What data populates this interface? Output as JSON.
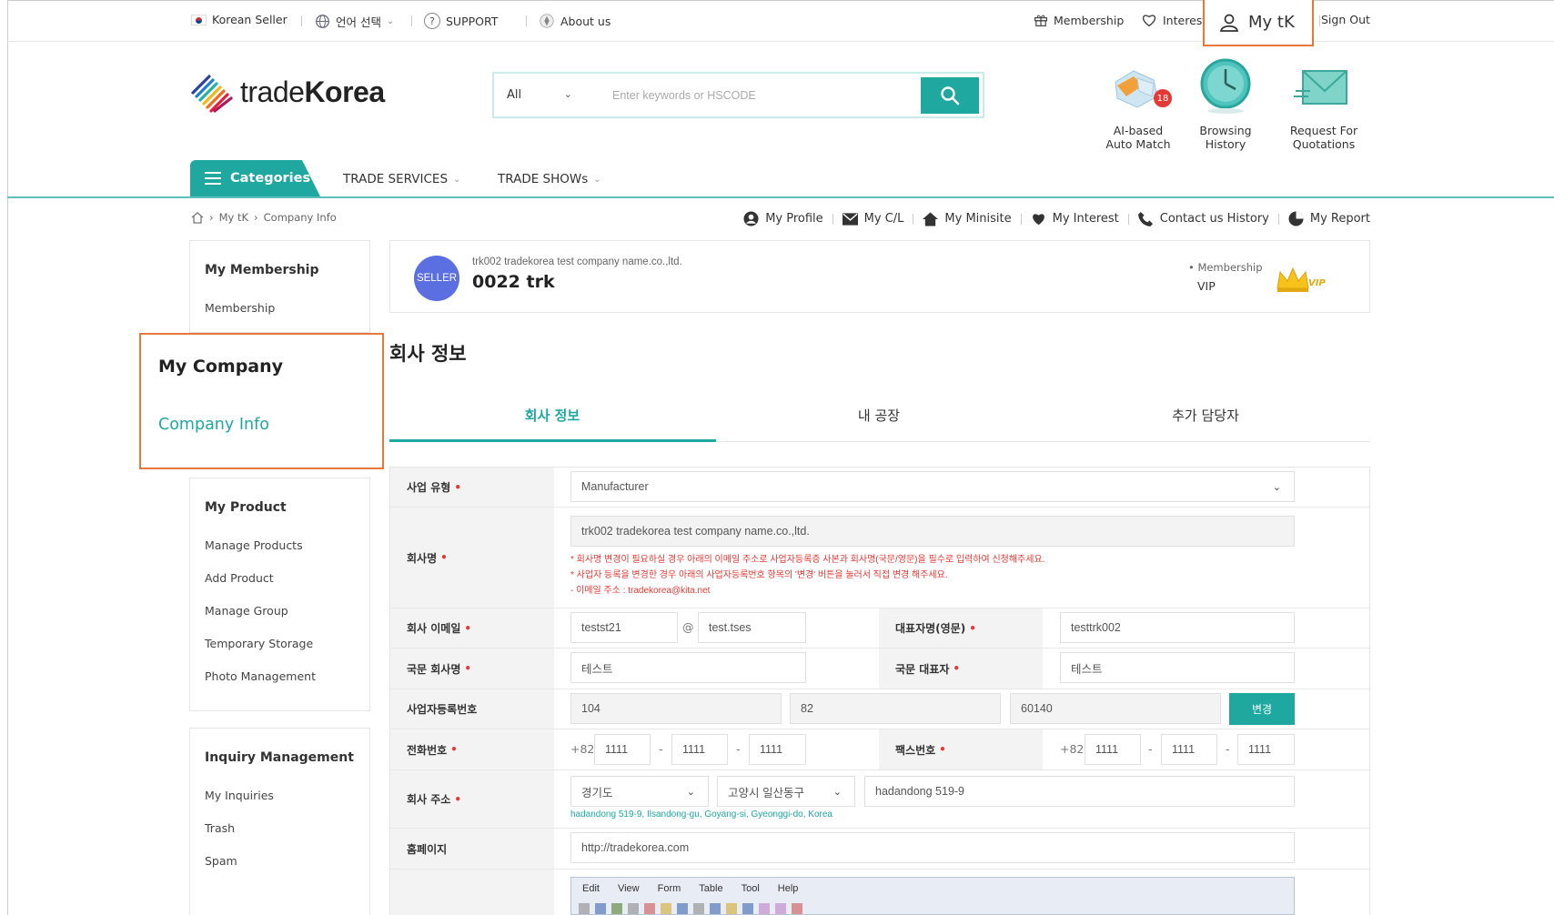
{
  "topbar": {
    "korean_seller": "Korean Seller",
    "language": "언어 선택",
    "support": "SUPPORT",
    "about": "About us",
    "membership": "Membership",
    "interest": "Interest",
    "mytk": "My tK",
    "signout": "Sign Out"
  },
  "header": {
    "logo_light": "trade",
    "logo_bold": "Korea",
    "search_category": "All",
    "search_placeholder": "Enter keywords or HSCODE",
    "quick": [
      {
        "line1": "AI-based",
        "line2": "Auto Match",
        "badge": "18"
      },
      {
        "line1": "Browsing",
        "line2": "History"
      },
      {
        "line1": "Request For",
        "line2": "Quotations"
      }
    ]
  },
  "nav": {
    "categories": "Categories",
    "trade_services": "TRADE SERVICES",
    "trade_shows": "TRADE SHOWs"
  },
  "breadcrumb": {
    "level1": "My tK",
    "level2": "Company Info"
  },
  "mylinks": [
    "My Profile",
    "My C/L",
    "My Minisite",
    "My Interest",
    "Contact us History",
    "My Report"
  ],
  "sidebar": {
    "membership_title": "My Membership",
    "membership_item": "Membership",
    "company_title": "My Company",
    "company_item": "Company Info",
    "product_title": "My Product",
    "product_items": [
      "Manage Products",
      "Add Product",
      "Manage Group",
      "Temporary Storage",
      "Photo Management"
    ],
    "inquiry_title": "Inquiry Management",
    "inquiry_items": [
      "My Inquiries",
      "Trash",
      "Spam"
    ]
  },
  "profile": {
    "badge": "SELLER",
    "company": "trk002 tradekorea test company name.co.,ltd.",
    "name": "0022 trk",
    "membership_label": "• Membership",
    "membership_value": "VIP",
    "vip_mark": "VIP"
  },
  "page": {
    "title": "회사 정보",
    "tabs": [
      "회사 정보",
      "내 공장",
      "추가 담당자"
    ]
  },
  "form": {
    "business_type_label": "사업 유형",
    "business_type_value": "Manufacturer",
    "company_name_label": "회사명",
    "company_name_value": "trk002 tradekorea test company name.co.,ltd.",
    "note1": "* 회사명 변경이 필요하실 경우 아래의 이메일 주소로 사업자등록증 사본과 회사명(국문/영문)을 필수로 입력하여 신청해주세요.",
    "note2": "* 사업자 등록을 변경한 경우 아래의 사업자등록번호 항목의 '변경' 버튼을 눌러서 직접 변경 해주세요.",
    "note3": "- 이메일 주소 : tradekorea@kita.net",
    "email_label": "회사 이메일",
    "email_user": "testst21",
    "email_at": "@",
    "email_domain": "test.tses",
    "rep_en_label": "대표자명(영문)",
    "rep_en_value": "testtrk002",
    "kor_company_label": "국문 회사명",
    "kor_company_value": "테스트",
    "kor_rep_label": "국문 대표자",
    "kor_rep_value": "테스트",
    "bizno_label": "사업자등록번호",
    "bizno": [
      "104",
      "82",
      "60140"
    ],
    "bizno_button": "변경",
    "phone_label": "전화번호",
    "phone_cc": "+82",
    "phone": [
      "1111",
      "1111",
      "1111"
    ],
    "fax_label": "팩스번호",
    "fax_cc": "+82",
    "fax": [
      "1111",
      "1111",
      "1111"
    ],
    "dash": "-",
    "address_label": "회사 주소",
    "address_province": "경기도",
    "address_city": "고양시 일산동구",
    "address_detail": "hadandong 519-9",
    "address_en": "hadandong 519-9, Ilsandong-gu, Goyang-si, Gyeonggi-do, Korea",
    "homepage_label": "홈페이지",
    "homepage_value": "http://tradekorea.com",
    "editor_menu": [
      "Edit",
      "View",
      "Form",
      "Table",
      "Tool",
      "Help"
    ]
  },
  "colors": {
    "accent": "#1fa8a0",
    "highlight": "#e8783a",
    "required": "#e53935"
  }
}
